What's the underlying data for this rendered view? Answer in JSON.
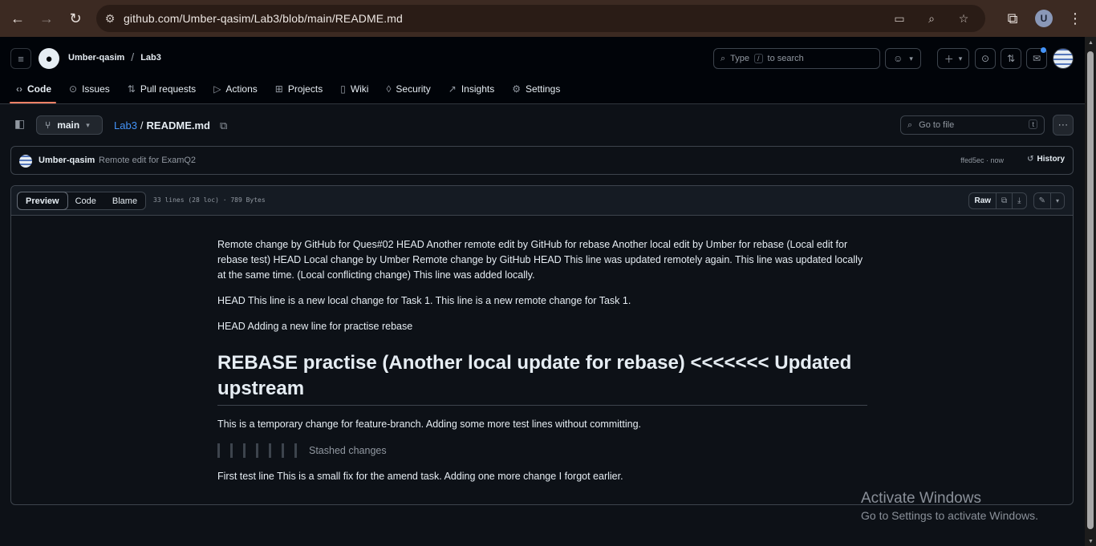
{
  "browser": {
    "url": "github.com/Umber-qasim/Lab3/blob/main/README.md",
    "profile_initial": "U"
  },
  "header": {
    "owner": "Umber-qasim",
    "separator": "/",
    "repo": "Lab3",
    "search_prefix": "Type",
    "search_key": "/",
    "search_suffix": "to search",
    "tabs": [
      {
        "label": "Code",
        "icon": "code-icon"
      },
      {
        "label": "Issues",
        "icon": "issue-icon"
      },
      {
        "label": "Pull requests",
        "icon": "pull-request-icon"
      },
      {
        "label": "Actions",
        "icon": "play-icon"
      },
      {
        "label": "Projects",
        "icon": "table-icon"
      },
      {
        "label": "Wiki",
        "icon": "book-icon"
      },
      {
        "label": "Security",
        "icon": "shield-icon"
      },
      {
        "label": "Insights",
        "icon": "graph-icon"
      },
      {
        "label": "Settings",
        "icon": "gear-icon"
      }
    ]
  },
  "filebar": {
    "branch": "main",
    "crumb_repo": "Lab3",
    "crumb_sep": "/",
    "crumb_file": "README.md",
    "goto_placeholder": "Go to file",
    "goto_key": "t"
  },
  "commit": {
    "author": "Umber-qasim",
    "message": "Remote edit for ExamQ2",
    "meta": "ffed5ec · now",
    "history": "History"
  },
  "fileview": {
    "tabs": [
      "Preview",
      "Code",
      "Blame"
    ],
    "info": "33 lines (28 loc) · 789 Bytes",
    "raw": "Raw"
  },
  "readme": {
    "p1": "Remote change by GitHub for Ques#02 HEAD Another remote edit by GitHub for rebase Another local edit by Umber for rebase (Local edit for rebase test) HEAD Local change by Umber Remote change by GitHub HEAD This line was updated remotely again. This line was updated locally at the same time. (Local conflicting change) This line was added locally.",
    "p2": "HEAD This line is a new local change for Task 1. This line is a new remote change for Task 1.",
    "p3": "HEAD Adding a new line for practise rebase",
    "h1": "REBASE practise (Another local update for rebase) <<<<<<< Updated upstream",
    "p4": "This is a temporary change for feature-branch. Adding some more test lines without committing.",
    "bq": "Stashed changes",
    "p5": "First test line This is a small fix for the amend task. Adding one more change I forgot earlier."
  },
  "watermark": {
    "line1": "Activate Windows",
    "line2": "Go to Settings to activate Windows."
  }
}
